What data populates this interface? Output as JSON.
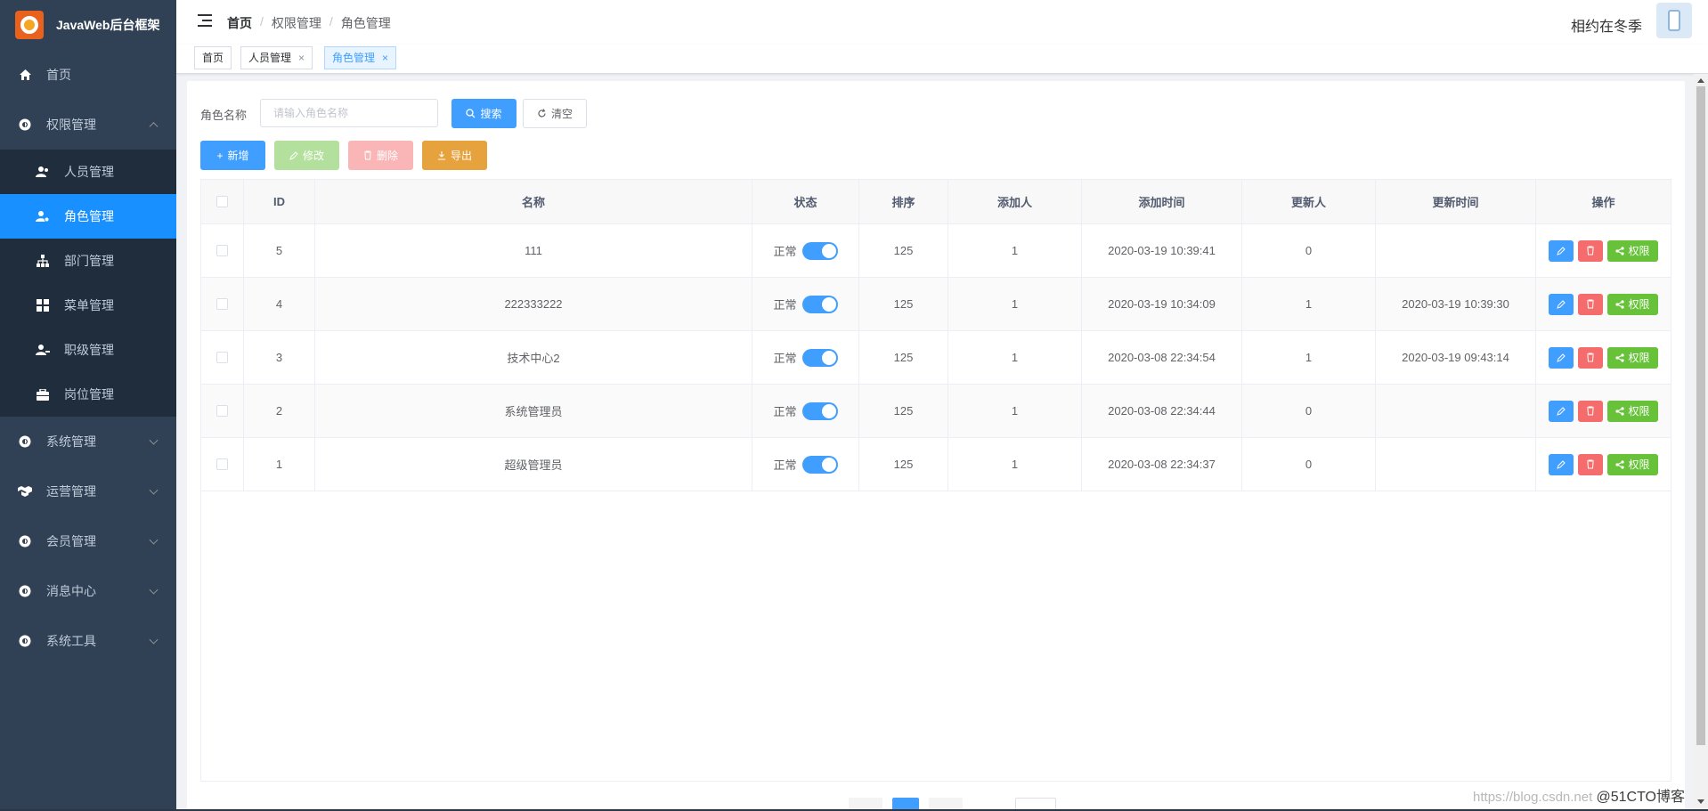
{
  "app": {
    "logo_text": "JavaWeb后台框架",
    "user_name": "相约在冬季"
  },
  "sidebar": {
    "items": [
      {
        "label": "首页",
        "icon": "home-icon"
      },
      {
        "label": "权限管理",
        "icon": "gear-icon",
        "expanded": true,
        "children": [
          {
            "label": "人员管理",
            "icon": "users-icon"
          },
          {
            "label": "角色管理",
            "icon": "user-role-icon",
            "active": true
          },
          {
            "label": "部门管理",
            "icon": "sitemap-icon"
          },
          {
            "label": "菜单管理",
            "icon": "grid-icon"
          },
          {
            "label": "职级管理",
            "icon": "user-rank-icon"
          },
          {
            "label": "岗位管理",
            "icon": "briefcase-icon"
          }
        ]
      },
      {
        "label": "系统管理",
        "icon": "gear-icon"
      },
      {
        "label": "运营管理",
        "icon": "cubes-icon"
      },
      {
        "label": "会员管理",
        "icon": "gear-icon"
      },
      {
        "label": "消息中心",
        "icon": "gear-icon"
      },
      {
        "label": "系统工具",
        "icon": "gear-icon"
      }
    ]
  },
  "breadcrumb": [
    "首页",
    "权限管理",
    "角色管理"
  ],
  "tags": [
    {
      "label": "首页",
      "closable": false,
      "active": false
    },
    {
      "label": "人员管理",
      "closable": true,
      "active": false
    },
    {
      "label": "角色管理",
      "closable": true,
      "active": true
    }
  ],
  "search": {
    "label": "角色名称",
    "placeholder": "请输入角色名称",
    "search_label": "搜索",
    "reset_label": "清空"
  },
  "toolbar": {
    "add_label": "新增",
    "edit_label": "修改",
    "delete_label": "删除",
    "export_label": "导出"
  },
  "table": {
    "columns": [
      "ID",
      "名称",
      "状态",
      "排序",
      "添加人",
      "添加时间",
      "更新人",
      "更新时间",
      "操作"
    ],
    "status_text": "正常",
    "perm_label": "权限",
    "rows": [
      {
        "id": "5",
        "name": "111",
        "sort": "125",
        "creator": "1",
        "created": "2020-03-19 10:39:41",
        "updater": "0",
        "updated": ""
      },
      {
        "id": "4",
        "name": "222333222",
        "sort": "125",
        "creator": "1",
        "created": "2020-03-19 10:34:09",
        "updater": "1",
        "updated": "2020-03-19 10:39:30"
      },
      {
        "id": "3",
        "name": "技术中心2",
        "sort": "125",
        "creator": "1",
        "created": "2020-03-08 22:34:54",
        "updater": "1",
        "updated": "2020-03-19 09:43:14"
      },
      {
        "id": "2",
        "name": "系统管理员",
        "sort": "125",
        "creator": "1",
        "created": "2020-03-08 22:34:44",
        "updater": "0",
        "updated": ""
      },
      {
        "id": "1",
        "name": "超级管理员",
        "sort": "125",
        "creator": "1",
        "created": "2020-03-08 22:34:37",
        "updater": "0",
        "updated": ""
      }
    ]
  },
  "watermark": {
    "url_text": "https://blog.csdn.net",
    "brand_text": "@51CTO博客"
  },
  "colors": {
    "sidebar_bg": "#304156",
    "active": "#1890ff",
    "primary": "#409eff",
    "success": "#67c23a",
    "danger": "#f56c6c",
    "warning": "#e6a23c"
  }
}
